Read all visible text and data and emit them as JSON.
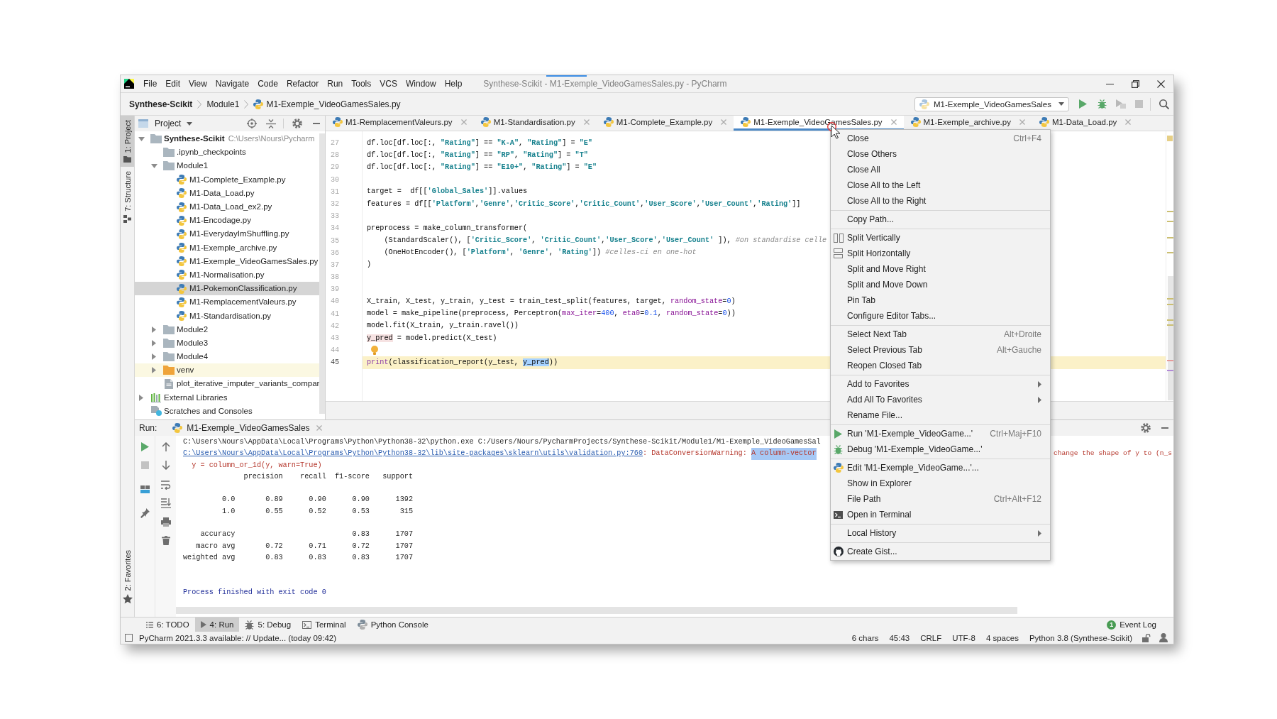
{
  "window": {
    "title": "Synthese-Scikit - M1-Exemple_VideoGamesSales.py - PyCharm"
  },
  "menu_bar": [
    "File",
    "Edit",
    "View",
    "Navigate",
    "Code",
    "Refactor",
    "Run",
    "Tools",
    "VCS",
    "Window",
    "Help"
  ],
  "breadcrumb": [
    {
      "label": "Synthese-Scikit",
      "kind": "project"
    },
    {
      "label": "Module1",
      "kind": "folder"
    },
    {
      "label": "M1-Exemple_VideoGamesSales.py",
      "kind": "file"
    }
  ],
  "run_config": {
    "label": "M1-Exemple_VideoGamesSales"
  },
  "tool_stripe": {
    "top": [
      {
        "label": "1: Project",
        "kind": "project",
        "selected": true
      },
      {
        "label": "7: Structure",
        "kind": "structure",
        "selected": false
      }
    ],
    "bottom": [
      {
        "label": "2: Favorites",
        "kind": "favorites",
        "selected": false
      }
    ]
  },
  "project_panel": {
    "title": "Project",
    "tree": [
      {
        "label": "Synthese-Scikit",
        "path": "C:\\Users\\Nours\\Pycharm",
        "kind": "project",
        "expanded": true,
        "selected": false,
        "children": [
          {
            "label": ".ipynb_checkpoints",
            "kind": "folder",
            "selected": false
          },
          {
            "label": "Module1",
            "kind": "folder",
            "expanded": true,
            "selected": false,
            "children": [
              {
                "label": "M1-Complete_Example.py",
                "kind": "python",
                "selected": false
              },
              {
                "label": "M1-Data_Load.py",
                "kind": "python",
                "selected": false
              },
              {
                "label": "M1-Data_Load_ex2.py",
                "kind": "python",
                "selected": false
              },
              {
                "label": "M1-Encodage.py",
                "kind": "python",
                "selected": false
              },
              {
                "label": "M1-EverydayImShuffling.py",
                "kind": "python",
                "selected": false
              },
              {
                "label": "M1-Exemple_archive.py",
                "kind": "python",
                "selected": false
              },
              {
                "label": "M1-Exemple_VideoGamesSales.py",
                "kind": "python",
                "selected": false
              },
              {
                "label": "M1-Normalisation.py",
                "kind": "python",
                "selected": false
              },
              {
                "label": "M1-PokemonClassification.py",
                "kind": "python",
                "selected": true
              },
              {
                "label": "M1-RemplacementValeurs.py",
                "kind": "python",
                "selected": false
              },
              {
                "label": "M1-Standardisation.py",
                "kind": "python",
                "selected": false
              }
            ]
          },
          {
            "label": "Module2",
            "kind": "folder",
            "expanded": false,
            "selected": false
          },
          {
            "label": "Module3",
            "kind": "folder",
            "expanded": false,
            "selected": false
          },
          {
            "label": "Module4",
            "kind": "folder",
            "expanded": false,
            "selected": false
          },
          {
            "label": "venv",
            "kind": "excluded",
            "expanded": false,
            "selected": false
          },
          {
            "label": "plot_iterative_imputer_variants_compar",
            "kind": "script",
            "selected": false
          }
        ]
      },
      {
        "label": "External Libraries",
        "kind": "library",
        "expanded": false,
        "selected": false
      },
      {
        "label": "Scratches and Consoles",
        "kind": "scratches",
        "selected": false
      }
    ]
  },
  "editor": {
    "tabs": [
      {
        "label": "M1-RemplacementValeurs.py",
        "selected": false
      },
      {
        "label": "M1-Standardisation.py",
        "selected": false
      },
      {
        "label": "M1-Complete_Example.py",
        "selected": false
      },
      {
        "label": "M1-Exemple_VideoGamesSales.py",
        "selected": true
      },
      {
        "label": "M1-Exemple_archive.py",
        "selected": false
      },
      {
        "label": "M1-Data_Load.py",
        "selected": false
      }
    ],
    "lines": [
      {
        "number": "27",
        "kind": "code",
        "current": false,
        "tokens": [
          {
            "text": "df.loc[df.loc[:, ",
            "kind": "plain"
          },
          {
            "text": "\"Rating\"",
            "kind": "string"
          },
          {
            "text": "] == ",
            "kind": "plain"
          },
          {
            "text": "\"K-A\"",
            "kind": "string"
          },
          {
            "text": ", ",
            "kind": "plain"
          },
          {
            "text": "\"Rating\"",
            "kind": "string"
          },
          {
            "text": "] = ",
            "kind": "plain"
          },
          {
            "text": "\"E\"",
            "kind": "string"
          }
        ]
      },
      {
        "number": "28",
        "kind": "code",
        "current": false,
        "tokens": [
          {
            "text": "df.loc[df.loc[:, ",
            "kind": "plain"
          },
          {
            "text": "\"Rating\"",
            "kind": "string"
          },
          {
            "text": "] == ",
            "kind": "plain"
          },
          {
            "text": "\"RP\"",
            "kind": "string"
          },
          {
            "text": ", ",
            "kind": "plain"
          },
          {
            "text": "\"Rating\"",
            "kind": "string"
          },
          {
            "text": "] = ",
            "kind": "plain"
          },
          {
            "text": "\"T\"",
            "kind": "string"
          }
        ]
      },
      {
        "number": "29",
        "kind": "code",
        "current": false,
        "tokens": [
          {
            "text": "df.loc[df.loc[:, ",
            "kind": "plain"
          },
          {
            "text": "\"Rating\"",
            "kind": "string"
          },
          {
            "text": "] == ",
            "kind": "plain"
          },
          {
            "text": "\"E10+\"",
            "kind": "string"
          },
          {
            "text": ", ",
            "kind": "plain"
          },
          {
            "text": "\"Rating\"",
            "kind": "string"
          },
          {
            "text": "] = ",
            "kind": "plain"
          },
          {
            "text": "\"E\"",
            "kind": "string"
          }
        ]
      },
      {
        "number": "30",
        "kind": "code",
        "current": false
      },
      {
        "number": "31",
        "kind": "code",
        "current": false,
        "tokens": [
          {
            "text": "target =  df[[",
            "kind": "plain"
          },
          {
            "text": "'Global_Sales'",
            "kind": "string"
          },
          {
            "text": "]].values",
            "kind": "plain"
          }
        ]
      },
      {
        "number": "32",
        "kind": "code",
        "current": false,
        "tokens": [
          {
            "text": "features = df[[",
            "kind": "plain"
          },
          {
            "text": "'Platform'",
            "kind": "string"
          },
          {
            "text": ",",
            "kind": "plain"
          },
          {
            "text": "'Genre'",
            "kind": "string"
          },
          {
            "text": ",",
            "kind": "plain"
          },
          {
            "text": "'Critic_Score'",
            "kind": "string"
          },
          {
            "text": ",",
            "kind": "plain"
          },
          {
            "text": "'Critic_Count'",
            "kind": "string"
          },
          {
            "text": ",",
            "kind": "plain"
          },
          {
            "text": "'User_Score'",
            "kind": "string"
          },
          {
            "text": ",",
            "kind": "plain"
          },
          {
            "text": "'User_Count'",
            "kind": "string"
          },
          {
            "text": ",",
            "kind": "plain"
          },
          {
            "text": "'Rating'",
            "kind": "string"
          },
          {
            "text": "]]",
            "kind": "plain"
          }
        ]
      },
      {
        "number": "33",
        "kind": "code",
        "current": false
      },
      {
        "number": "34",
        "kind": "code",
        "current": false,
        "tokens": [
          {
            "text": "preprocess = make_column_transformer(",
            "kind": "plain"
          }
        ]
      },
      {
        "number": "35",
        "kind": "code",
        "current": false,
        "tokens": [
          {
            "text": "    (StandardScaler(), [",
            "kind": "plain"
          },
          {
            "text": "'Critic_Score'",
            "kind": "string"
          },
          {
            "text": ", ",
            "kind": "plain"
          },
          {
            "text": "'Critic_Count'",
            "kind": "string"
          },
          {
            "text": ",",
            "kind": "plain"
          },
          {
            "text": "'User_Score'",
            "kind": "string"
          },
          {
            "text": ",",
            "kind": "plain"
          },
          {
            "text": "'User_Count'",
            "kind": "string"
          },
          {
            "text": " ]), ",
            "kind": "plain"
          },
          {
            "text": "#on standardise celle",
            "kind": "comment"
          }
        ]
      },
      {
        "number": "36",
        "kind": "code",
        "current": false,
        "tokens": [
          {
            "text": "    (OneHotEncoder(), [",
            "kind": "plain"
          },
          {
            "text": "'Platform'",
            "kind": "string"
          },
          {
            "text": ", ",
            "kind": "plain"
          },
          {
            "text": "'Genre'",
            "kind": "string"
          },
          {
            "text": ", ",
            "kind": "plain"
          },
          {
            "text": "'Rating'",
            "kind": "string"
          },
          {
            "text": "]) ",
            "kind": "plain"
          },
          {
            "text": "#celles-ci en one-hot",
            "kind": "comment"
          }
        ]
      },
      {
        "number": "37",
        "kind": "code",
        "current": false,
        "tokens": [
          {
            "text": ")",
            "kind": "plain"
          }
        ]
      },
      {
        "number": "38",
        "kind": "code",
        "current": false
      },
      {
        "number": "39",
        "kind": "code",
        "current": false
      },
      {
        "number": "40",
        "kind": "code",
        "current": false,
        "tokens": [
          {
            "text": "X_train, X_test, y_train, y_test = train_test_split(features, target, ",
            "kind": "plain"
          },
          {
            "text": "random_state",
            "kind": "param"
          },
          {
            "text": "=",
            "kind": "plain"
          },
          {
            "text": "0",
            "kind": "number"
          },
          {
            "text": ")",
            "kind": "plain"
          }
        ]
      },
      {
        "number": "41",
        "kind": "code",
        "current": false,
        "tokens": [
          {
            "text": "model = make_pipeline(preprocess, Perceptron(",
            "kind": "plain"
          },
          {
            "text": "max_iter",
            "kind": "param"
          },
          {
            "text": "=",
            "kind": "plain"
          },
          {
            "text": "400",
            "kind": "number"
          },
          {
            "text": ", ",
            "kind": "plain"
          },
          {
            "text": "eta0",
            "kind": "param"
          },
          {
            "text": "=",
            "kind": "plain"
          },
          {
            "text": "0.1",
            "kind": "number"
          },
          {
            "text": ", ",
            "kind": "plain"
          },
          {
            "text": "random_state",
            "kind": "param"
          },
          {
            "text": "=",
            "kind": "plain"
          },
          {
            "text": "0",
            "kind": "number"
          },
          {
            "text": "))",
            "kind": "plain"
          }
        ]
      },
      {
        "number": "42",
        "kind": "code",
        "current": false,
        "tokens": [
          {
            "text": "model.fit(X_train, y_train.ravel())",
            "kind": "plain"
          }
        ]
      },
      {
        "number": "43",
        "kind": "code",
        "current": false,
        "tokens": [
          {
            "text": "y_pred",
            "kind": "usage"
          },
          {
            "text": " = model.predict(X_test)",
            "kind": "plain"
          }
        ]
      },
      {
        "number": "44",
        "kind": "hint",
        "current": false
      },
      {
        "number": "45",
        "kind": "code",
        "current": true,
        "tokens": [
          {
            "text": "print",
            "kind": "builtin"
          },
          {
            "text": "(classification_report(y_test, ",
            "kind": "plain"
          },
          {
            "text": "y_pred",
            "kind": "selection"
          },
          {
            "text": "))",
            "kind": "plain"
          }
        ]
      }
    ]
  },
  "context_menu": {
    "groups": [
      [
        {
          "label": "Close",
          "shortcut": "Ctrl+F4",
          "kind": "plain"
        },
        {
          "label": "Close Others",
          "kind": "plain"
        },
        {
          "label": "Close All",
          "kind": "plain"
        },
        {
          "label": "Close All to the Left",
          "kind": "plain"
        },
        {
          "label": "Close All to the Right",
          "kind": "plain"
        }
      ],
      [
        {
          "label": "Copy Path...",
          "kind": "plain"
        }
      ],
      [
        {
          "label": "Split Vertically",
          "kind": "vsplit"
        },
        {
          "label": "Split Horizontally",
          "kind": "hsplit"
        },
        {
          "label": "Split and Move Right",
          "kind": "plain"
        },
        {
          "label": "Split and Move Down",
          "kind": "plain"
        },
        {
          "label": "Pin Tab",
          "kind": "plain"
        },
        {
          "label": "Configure Editor Tabs...",
          "kind": "plain"
        }
      ],
      [
        {
          "label": "Select Next Tab",
          "shortcut": "Alt+Droite",
          "kind": "plain"
        },
        {
          "label": "Select Previous Tab",
          "shortcut": "Alt+Gauche",
          "kind": "plain"
        },
        {
          "label": "Reopen Closed Tab",
          "kind": "plain"
        }
      ],
      [
        {
          "label": "Add to Favorites",
          "kind": "submenu"
        },
        {
          "label": "Add All To Favorites",
          "kind": "submenu"
        },
        {
          "label": "Rename File...",
          "kind": "plain"
        }
      ],
      [
        {
          "label": "Run 'M1-Exemple_VideoGame...'",
          "shortcut": "Ctrl+Maj+F10",
          "kind": "run"
        },
        {
          "label": "Debug 'M1-Exemple_VideoGame...'",
          "kind": "debug"
        }
      ],
      [
        {
          "label": "Edit 'M1-Exemple_VideoGame...'...",
          "kind": "python"
        },
        {
          "label": "Show in Explorer",
          "kind": "plain"
        },
        {
          "label": "File Path",
          "shortcut": "Ctrl+Alt+F12",
          "kind": "plain"
        },
        {
          "label": "Open in Terminal",
          "kind": "terminal"
        }
      ],
      [
        {
          "label": "Local History",
          "kind": "submenu"
        }
      ],
      [
        {
          "label": "Create Gist...",
          "kind": "gist"
        }
      ]
    ]
  },
  "run_panel": {
    "label": "Run:",
    "tab": {
      "label": "M1-Exemple_VideoGamesSales"
    },
    "console": [
      {
        "kind": "command",
        "text": "C:\\Users\\Nours\\AppData\\Local\\Programs\\Python\\Python38-32\\python.exe C:/Users/Nours/PycharmProjects/Synthese-Scikit/Module1/M1-Exemple_VideoGamesSal"
      },
      {
        "kind": "warning",
        "segments": [
          {
            "kind": "link",
            "text": "C:\\Users\\Nours\\AppData\\Local\\Programs\\Python\\Python38-32\\lib\\site-packages\\sklearn\\utils\\validation.py:760"
          },
          {
            "kind": "message",
            "text": ": DataConversionWarning: "
          },
          {
            "kind": "selection",
            "text": "A column-vector"
          }
        ],
        "continuation": "change the shape of y to (n_s"
      },
      {
        "kind": "error",
        "text": "  y = column_or_1d(y, warn=True)"
      },
      {
        "kind": "output",
        "text": "              precision    recall  f1-score   support"
      },
      {
        "kind": "blank"
      },
      {
        "kind": "output",
        "text": "         0.0       0.89      0.90      0.90      1392"
      },
      {
        "kind": "output",
        "text": "         1.0       0.55      0.52      0.53       315"
      },
      {
        "kind": "blank"
      },
      {
        "kind": "output",
        "text": "    accuracy                           0.83      1707"
      },
      {
        "kind": "output",
        "text": "   macro avg       0.72      0.71      0.72      1707"
      },
      {
        "kind": "output",
        "text": "weighted avg       0.83      0.83      0.83      1707"
      },
      {
        "kind": "blank"
      },
      {
        "kind": "blank"
      },
      {
        "kind": "exit",
        "text": "Process finished with exit code 0"
      }
    ]
  },
  "tool_window_bar": {
    "items": [
      {
        "label": "6: TODO",
        "kind": "todo",
        "selected": false
      },
      {
        "label": "4: Run",
        "kind": "run",
        "selected": true
      },
      {
        "label": "5: Debug",
        "kind": "debug",
        "selected": false
      },
      {
        "label": "Terminal",
        "kind": "terminal",
        "selected": false
      },
      {
        "label": "Python Console",
        "kind": "python",
        "selected": false
      }
    ],
    "event_log": {
      "label": "Event Log",
      "badge": "1"
    }
  },
  "status_bar": {
    "message": "PyCharm 2021.3.3 available: // Update... (today 09:42)",
    "items": [
      "6 chars",
      "45:43",
      "CRLF",
      "UTF-8",
      "4 spaces",
      "Python 3.8 (Synthese-Scikit)"
    ]
  }
}
